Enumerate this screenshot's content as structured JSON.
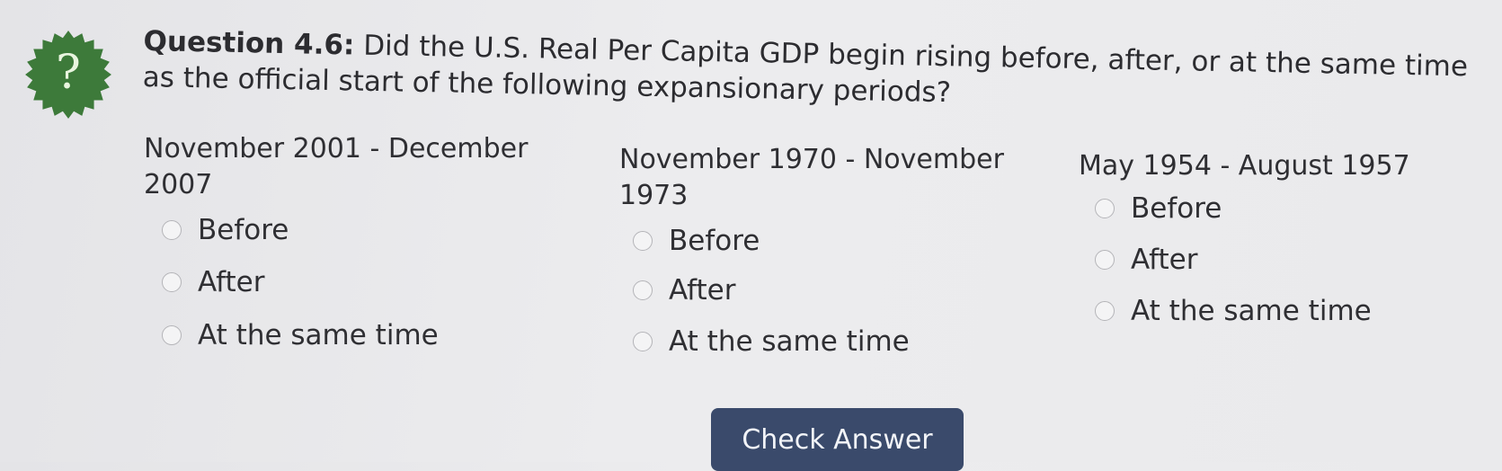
{
  "badge": {
    "glyph": "?",
    "color": "#3d7a3a"
  },
  "question": {
    "label": "Question 4.6:",
    "text": "Did the U.S. Real Per Capita GDP begin rising before, after, or at the same time as the official start of the following expansionary periods?"
  },
  "columns": [
    {
      "title": "November 2001 - December 2007",
      "options": [
        "Before",
        "After",
        "At the same time"
      ]
    },
    {
      "title": "November 1970 - November 1973",
      "options": [
        "Before",
        "After",
        "At the same time"
      ]
    },
    {
      "title": "May 1954 - August 1957",
      "options": [
        "Before",
        "After",
        "At the same time"
      ]
    }
  ],
  "submit": {
    "label": "Check Answer"
  }
}
